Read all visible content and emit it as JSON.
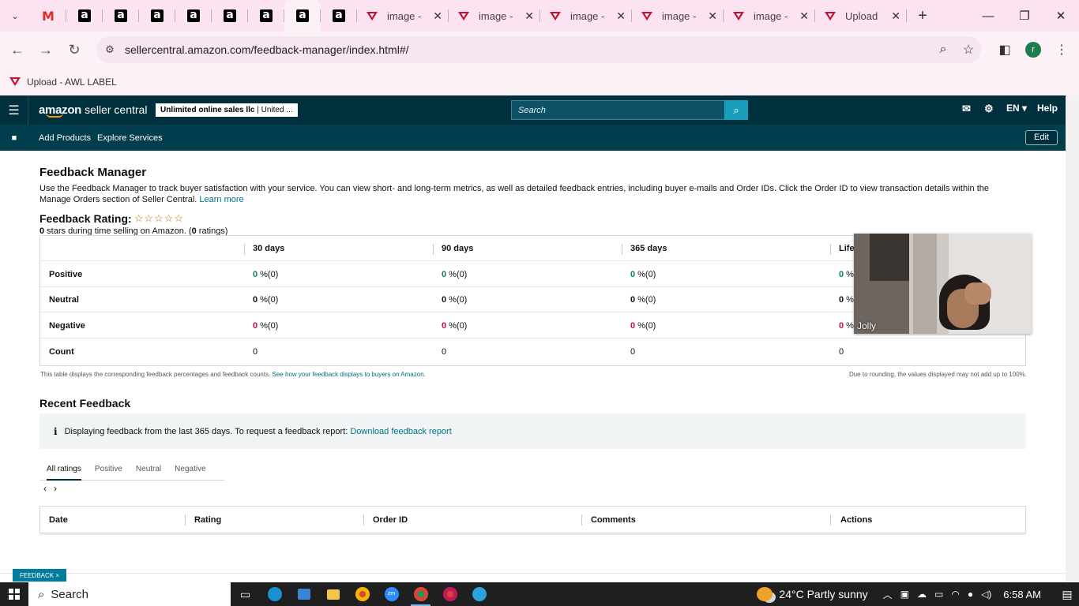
{
  "browser": {
    "tabs": [
      {
        "type": "gmail",
        "title": ""
      },
      {
        "type": "amazon",
        "title": ""
      },
      {
        "type": "amazon",
        "title": ""
      },
      {
        "type": "amazon",
        "title": ""
      },
      {
        "type": "amazon",
        "title": ""
      },
      {
        "type": "amazon",
        "title": ""
      },
      {
        "type": "amazon",
        "title": ""
      },
      {
        "type": "amazon",
        "title": "",
        "active": true
      },
      {
        "type": "amazon",
        "title": ""
      }
    ],
    "image_tabs": [
      "image -",
      "image -",
      "image -",
      "image -",
      "image -",
      "Upload"
    ],
    "new_tab": "+",
    "url": "sellercentral.amazon.com/feedback-manager/index.html#/",
    "bookmark": "Upload - AWL LABEL",
    "profile_initial": "r"
  },
  "seller_central": {
    "logo_brand": "amazon",
    "logo_product": "seller central",
    "account_name": "Unlimited online sales llc",
    "account_region": "| United ...",
    "search_placeholder": "Search",
    "language": "EN",
    "help": "Help",
    "subnav": [
      "Add Products",
      "Explore Services"
    ],
    "edit": "Edit"
  },
  "page": {
    "title": "Feedback Manager",
    "description": "Use the Feedback Manager to track buyer satisfaction with your service. You can view short- and long-term metrics, as well as detailed feedback entries, including buyer e-mails and Order IDs. Click the Order ID to view transaction details within the Manage Orders section of Seller Central.",
    "learn_more": "Learn more",
    "rating_label": "Feedback Rating:",
    "stars": "☆☆☆☆☆",
    "stars_count": "0",
    "stars_note_mid": " stars during time selling on Amazon. (",
    "ratings_count": "0",
    "stars_note_end": " ratings)",
    "table": {
      "headers": [
        "",
        "30 days",
        "90 days",
        "365 days",
        "Lifetime"
      ],
      "rows": [
        {
          "label": "Positive",
          "kind": "pos",
          "values": [
            "0",
            "0",
            "0",
            "0"
          ],
          "suffix": "%(0)"
        },
        {
          "label": "Neutral",
          "kind": "neu",
          "values": [
            "0",
            "0",
            "0",
            "0"
          ],
          "suffix": "%(0)"
        },
        {
          "label": "Negative",
          "kind": "neg",
          "values": [
            "0",
            "0",
            "0",
            "0"
          ],
          "suffix": "%(0)"
        },
        {
          "label": "Count",
          "kind": "count",
          "values": [
            "0",
            "0",
            "0",
            "0"
          ],
          "suffix": ""
        }
      ]
    },
    "table_note": "This table displays the corresponding feedback percentages and feedback counts.",
    "table_note_link": "See how your feedback displays to buyers on Amazon.",
    "rounding_note": "Due to rounding, the values displayed may not add up to 100%.",
    "recent_title": "Recent Feedback",
    "info_text": "Displaying feedback from the last 365 days. To request a feedback report:",
    "info_link": "Download feedback report",
    "filter_tabs": [
      "All ratings",
      "Positive",
      "Neutral",
      "Negative"
    ],
    "pager_prev": "‹",
    "pager_next": "›",
    "recent_headers": [
      "Date",
      "Rating",
      "Order ID",
      "Comments",
      "Actions"
    ],
    "feedback_tag": "FEEDBACK ×"
  },
  "video": {
    "name": "Jolly"
  },
  "taskbar": {
    "search": "Search",
    "weather": "24°C  Partly sunny",
    "time": "6:58 AM"
  },
  "colors": {
    "header": "#00303d",
    "subnav": "#003d4d",
    "accent": "#199fbb",
    "link": "#007185",
    "positive": "#067d62",
    "negative": "#cc0c39",
    "tabstrip": "#fbe3f1"
  }
}
